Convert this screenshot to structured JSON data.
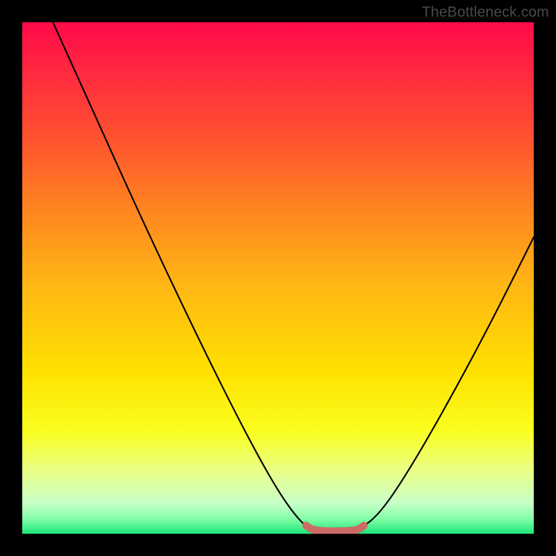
{
  "watermark": "TheBottleneck.com",
  "chart_data": {
    "type": "line",
    "title": "",
    "xlabel": "",
    "ylabel": "",
    "xlim": [
      0,
      100
    ],
    "ylim": [
      0,
      100
    ],
    "grid": false,
    "series": [
      {
        "name": "curve",
        "color": "#000000",
        "x": [
          6,
          15,
          25,
          35,
          43,
          49,
          53,
          56,
          58.5,
          64,
          66,
          70,
          76,
          84,
          92,
          100
        ],
        "values": [
          100,
          80,
          58,
          37,
          21,
          10,
          4,
          0.9,
          0.6,
          0.6,
          0.9,
          4,
          13,
          27,
          42,
          58
        ]
      },
      {
        "name": "floor-highlight",
        "color": "#cc6b66",
        "x": [
          55.5,
          56.3,
          57.2,
          58.2,
          59.5,
          61.0,
          62.5,
          64.0,
          65.2,
          66.0,
          66.8
        ],
        "values": [
          1.6,
          1.0,
          0.72,
          0.58,
          0.52,
          0.5,
          0.52,
          0.58,
          0.72,
          1.0,
          1.6
        ]
      }
    ]
  }
}
